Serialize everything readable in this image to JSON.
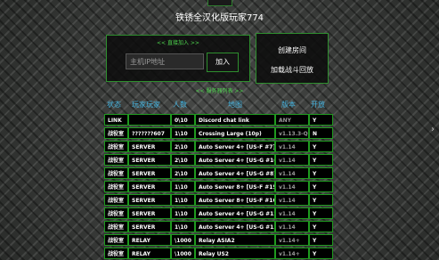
{
  "app": {
    "title": "铁锈全汉化版玩家774"
  },
  "join": {
    "header": "<< 直接加入 >>",
    "ip_value": "主机IP地址",
    "join_label": "加入"
  },
  "side": {
    "create_label": "创建房间",
    "replay_label": "加载战斗回放"
  },
  "list": {
    "header": "<< 服务器列表 >>",
    "columns": [
      "状态",
      "玩家玩家",
      "人数",
      "地图",
      "版本",
      "开放"
    ],
    "rows": [
      [
        "LINK",
        "",
        "0\\10",
        "Discord chat link",
        "ANY",
        "Y"
      ],
      [
        "战役室",
        "???????607",
        "1\\10",
        "Crossing Large (10p)",
        "v1.13.3-Q",
        "N"
      ],
      [
        "战役室",
        "SERVER",
        "2\\10",
        "Auto Server 4+ [US-F #7]",
        "v1.14",
        "Y"
      ],
      [
        "战役室",
        "SERVER",
        "2\\10",
        "Auto Server 4+ [US-G #10]",
        "v1.14",
        "Y"
      ],
      [
        "战役室",
        "SERVER",
        "2\\10",
        "Auto Server 4+ [US-G #8]",
        "v1.14",
        "Y"
      ],
      [
        "战役室",
        "SERVER",
        "1\\10",
        "Auto Server 8+ [US-F #15]",
        "v1.14",
        "Y"
      ],
      [
        "战役室",
        "SERVER",
        "1\\10",
        "Auto Server 8+ [US-F #16]",
        "v1.14",
        "Y"
      ],
      [
        "战役室",
        "SERVER",
        "1\\10",
        "Auto Server 4+ [US-G #12]",
        "v1.14",
        "Y"
      ],
      [
        "战役室",
        "SERVER",
        "1\\10",
        "Auto Server 4+ [US-G #13]",
        "v1.14",
        "Y"
      ],
      [
        "战役室",
        "RELAY",
        "\\1000",
        "Relay ASIA2",
        "v1.14+",
        "Y"
      ],
      [
        "战役室",
        "RELAY",
        "\\1000",
        "Relay US2",
        "v1.14+",
        "Y"
      ]
    ]
  },
  "colors": {
    "accent_green": "#2e8f2e",
    "header_blue": "#45b4e0"
  },
  "icons": {
    "scroll": "chevron-right-icon"
  }
}
